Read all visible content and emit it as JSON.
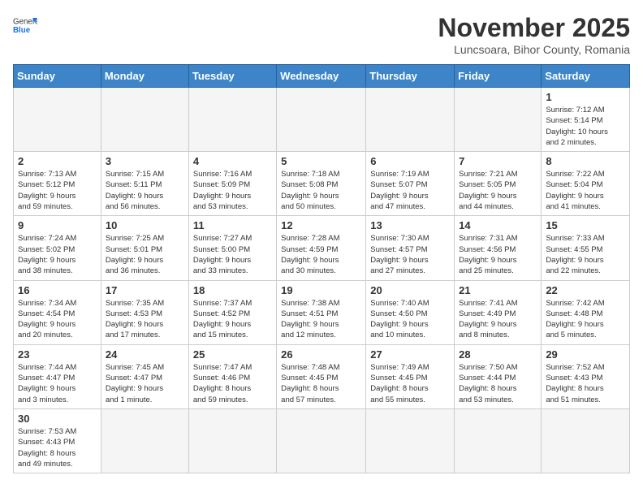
{
  "header": {
    "logo_general": "General",
    "logo_blue": "Blue",
    "month_title": "November 2025",
    "location": "Luncsoara, Bihor County, Romania"
  },
  "weekdays": [
    "Sunday",
    "Monday",
    "Tuesday",
    "Wednesday",
    "Thursday",
    "Friday",
    "Saturday"
  ],
  "weeks": [
    [
      {
        "day": "",
        "info": ""
      },
      {
        "day": "",
        "info": ""
      },
      {
        "day": "",
        "info": ""
      },
      {
        "day": "",
        "info": ""
      },
      {
        "day": "",
        "info": ""
      },
      {
        "day": "",
        "info": ""
      },
      {
        "day": "1",
        "info": "Sunrise: 7:12 AM\nSunset: 5:14 PM\nDaylight: 10 hours\nand 2 minutes."
      }
    ],
    [
      {
        "day": "2",
        "info": "Sunrise: 7:13 AM\nSunset: 5:12 PM\nDaylight: 9 hours\nand 59 minutes."
      },
      {
        "day": "3",
        "info": "Sunrise: 7:15 AM\nSunset: 5:11 PM\nDaylight: 9 hours\nand 56 minutes."
      },
      {
        "day": "4",
        "info": "Sunrise: 7:16 AM\nSunset: 5:09 PM\nDaylight: 9 hours\nand 53 minutes."
      },
      {
        "day": "5",
        "info": "Sunrise: 7:18 AM\nSunset: 5:08 PM\nDaylight: 9 hours\nand 50 minutes."
      },
      {
        "day": "6",
        "info": "Sunrise: 7:19 AM\nSunset: 5:07 PM\nDaylight: 9 hours\nand 47 minutes."
      },
      {
        "day": "7",
        "info": "Sunrise: 7:21 AM\nSunset: 5:05 PM\nDaylight: 9 hours\nand 44 minutes."
      },
      {
        "day": "8",
        "info": "Sunrise: 7:22 AM\nSunset: 5:04 PM\nDaylight: 9 hours\nand 41 minutes."
      }
    ],
    [
      {
        "day": "9",
        "info": "Sunrise: 7:24 AM\nSunset: 5:02 PM\nDaylight: 9 hours\nand 38 minutes."
      },
      {
        "day": "10",
        "info": "Sunrise: 7:25 AM\nSunset: 5:01 PM\nDaylight: 9 hours\nand 36 minutes."
      },
      {
        "day": "11",
        "info": "Sunrise: 7:27 AM\nSunset: 5:00 PM\nDaylight: 9 hours\nand 33 minutes."
      },
      {
        "day": "12",
        "info": "Sunrise: 7:28 AM\nSunset: 4:59 PM\nDaylight: 9 hours\nand 30 minutes."
      },
      {
        "day": "13",
        "info": "Sunrise: 7:30 AM\nSunset: 4:57 PM\nDaylight: 9 hours\nand 27 minutes."
      },
      {
        "day": "14",
        "info": "Sunrise: 7:31 AM\nSunset: 4:56 PM\nDaylight: 9 hours\nand 25 minutes."
      },
      {
        "day": "15",
        "info": "Sunrise: 7:33 AM\nSunset: 4:55 PM\nDaylight: 9 hours\nand 22 minutes."
      }
    ],
    [
      {
        "day": "16",
        "info": "Sunrise: 7:34 AM\nSunset: 4:54 PM\nDaylight: 9 hours\nand 20 minutes."
      },
      {
        "day": "17",
        "info": "Sunrise: 7:35 AM\nSunset: 4:53 PM\nDaylight: 9 hours\nand 17 minutes."
      },
      {
        "day": "18",
        "info": "Sunrise: 7:37 AM\nSunset: 4:52 PM\nDaylight: 9 hours\nand 15 minutes."
      },
      {
        "day": "19",
        "info": "Sunrise: 7:38 AM\nSunset: 4:51 PM\nDaylight: 9 hours\nand 12 minutes."
      },
      {
        "day": "20",
        "info": "Sunrise: 7:40 AM\nSunset: 4:50 PM\nDaylight: 9 hours\nand 10 minutes."
      },
      {
        "day": "21",
        "info": "Sunrise: 7:41 AM\nSunset: 4:49 PM\nDaylight: 9 hours\nand 8 minutes."
      },
      {
        "day": "22",
        "info": "Sunrise: 7:42 AM\nSunset: 4:48 PM\nDaylight: 9 hours\nand 5 minutes."
      }
    ],
    [
      {
        "day": "23",
        "info": "Sunrise: 7:44 AM\nSunset: 4:47 PM\nDaylight: 9 hours\nand 3 minutes."
      },
      {
        "day": "24",
        "info": "Sunrise: 7:45 AM\nSunset: 4:47 PM\nDaylight: 9 hours\nand 1 minute."
      },
      {
        "day": "25",
        "info": "Sunrise: 7:47 AM\nSunset: 4:46 PM\nDaylight: 8 hours\nand 59 minutes."
      },
      {
        "day": "26",
        "info": "Sunrise: 7:48 AM\nSunset: 4:45 PM\nDaylight: 8 hours\nand 57 minutes."
      },
      {
        "day": "27",
        "info": "Sunrise: 7:49 AM\nSunset: 4:45 PM\nDaylight: 8 hours\nand 55 minutes."
      },
      {
        "day": "28",
        "info": "Sunrise: 7:50 AM\nSunset: 4:44 PM\nDaylight: 8 hours\nand 53 minutes."
      },
      {
        "day": "29",
        "info": "Sunrise: 7:52 AM\nSunset: 4:43 PM\nDaylight: 8 hours\nand 51 minutes."
      }
    ],
    [
      {
        "day": "30",
        "info": "Sunrise: 7:53 AM\nSunset: 4:43 PM\nDaylight: 8 hours\nand 49 minutes."
      },
      {
        "day": "",
        "info": ""
      },
      {
        "day": "",
        "info": ""
      },
      {
        "day": "",
        "info": ""
      },
      {
        "day": "",
        "info": ""
      },
      {
        "day": "",
        "info": ""
      },
      {
        "day": "",
        "info": ""
      }
    ]
  ]
}
